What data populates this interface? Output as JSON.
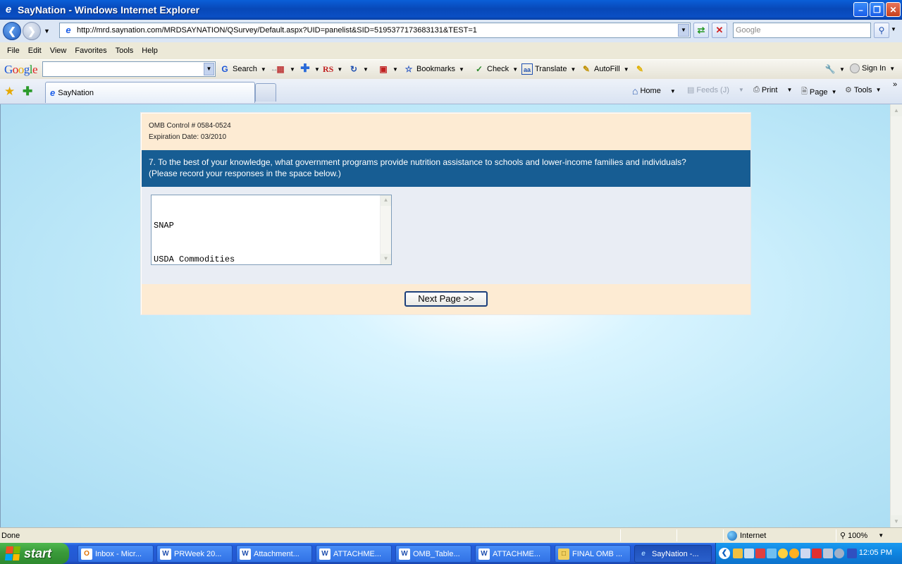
{
  "window": {
    "title": "SayNation - Windows Internet Explorer"
  },
  "address": {
    "url": "http://mrd.saynation.com/MRDSAYNATION/QSurvey/Default.aspx?UID=panelist&SID=5195377173683131&TEST=1",
    "search_placeholder": "Google"
  },
  "menu": [
    "File",
    "Edit",
    "View",
    "Favorites",
    "Tools",
    "Help"
  ],
  "google_toolbar": {
    "search": "Search",
    "bookmarks": "Bookmarks",
    "check": "Check",
    "translate": "Translate",
    "autofill": "AutoFill",
    "sign_in": "Sign In"
  },
  "tab": {
    "title": "SayNation"
  },
  "commands": {
    "home": "Home",
    "feeds": "Feeds (J)",
    "print": "Print",
    "page": "Page",
    "tools": "Tools"
  },
  "survey": {
    "omb_control": "OMB Control # 0584-0524",
    "expiration": "Expiration Date: 03/2010",
    "question_line1": "7.  To the best of your knowledge, what government programs provide nutrition assistance to schools and lower-income families and individuals?",
    "question_line2": "(Please record your responses in the space below.)",
    "answer_lines": [
      "SNAP",
      "USDA Commodities"
    ],
    "next_button": "Next Page >>"
  },
  "status": {
    "text": "Done",
    "zone": "Internet",
    "zoom": "100%"
  },
  "taskbar": {
    "start": "start",
    "items": [
      "Inbox - Micr...",
      "PRWeek 20...",
      "Attachment...",
      "ATTACHME...",
      "OMB_Table...",
      "ATTACHME...",
      "FINAL OMB ...",
      "SayNation -..."
    ],
    "clock": "12:05 PM"
  }
}
